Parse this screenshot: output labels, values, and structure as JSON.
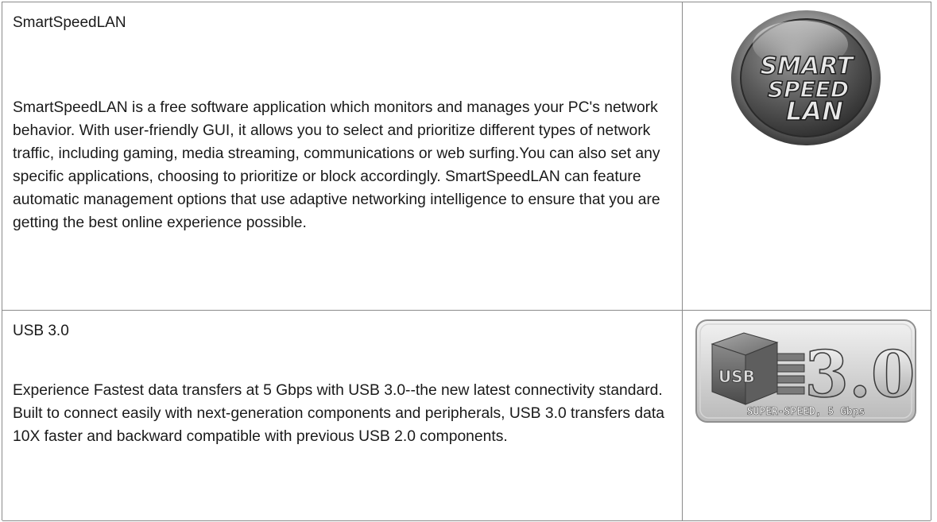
{
  "features": [
    {
      "title": "SmartSpeedLAN",
      "body": "SmartSpeedLAN is a free software application which monitors and manages your PC's network behavior. With user-friendly GUI, it allows you to select and prioritize different types of network traffic, including gaming, media streaming, communications or web surfing.You can also set any specific applications, choosing to prioritize or block accordingly. SmartSpeedLAN can feature automatic management options that use adaptive networking intelligence to ensure that you are getting the best online experience possible.",
      "logo_text": [
        "SMART",
        "SPEED",
        "LAN"
      ]
    },
    {
      "title": "USB 3.0",
      "body": "Experience Fastest data transfers at 5 Gbps with USB 3.0--the new latest connectivity standard. Built to connect easily with next-generation components and peripherals, USB 3.0 transfers data 10X faster and backward compatible with previous USB 2.0 components.",
      "logo_text": {
        "usb": "USB",
        "version": "3.0",
        "tagline": "SUPER-SPEED, 5 Gbps"
      }
    }
  ]
}
